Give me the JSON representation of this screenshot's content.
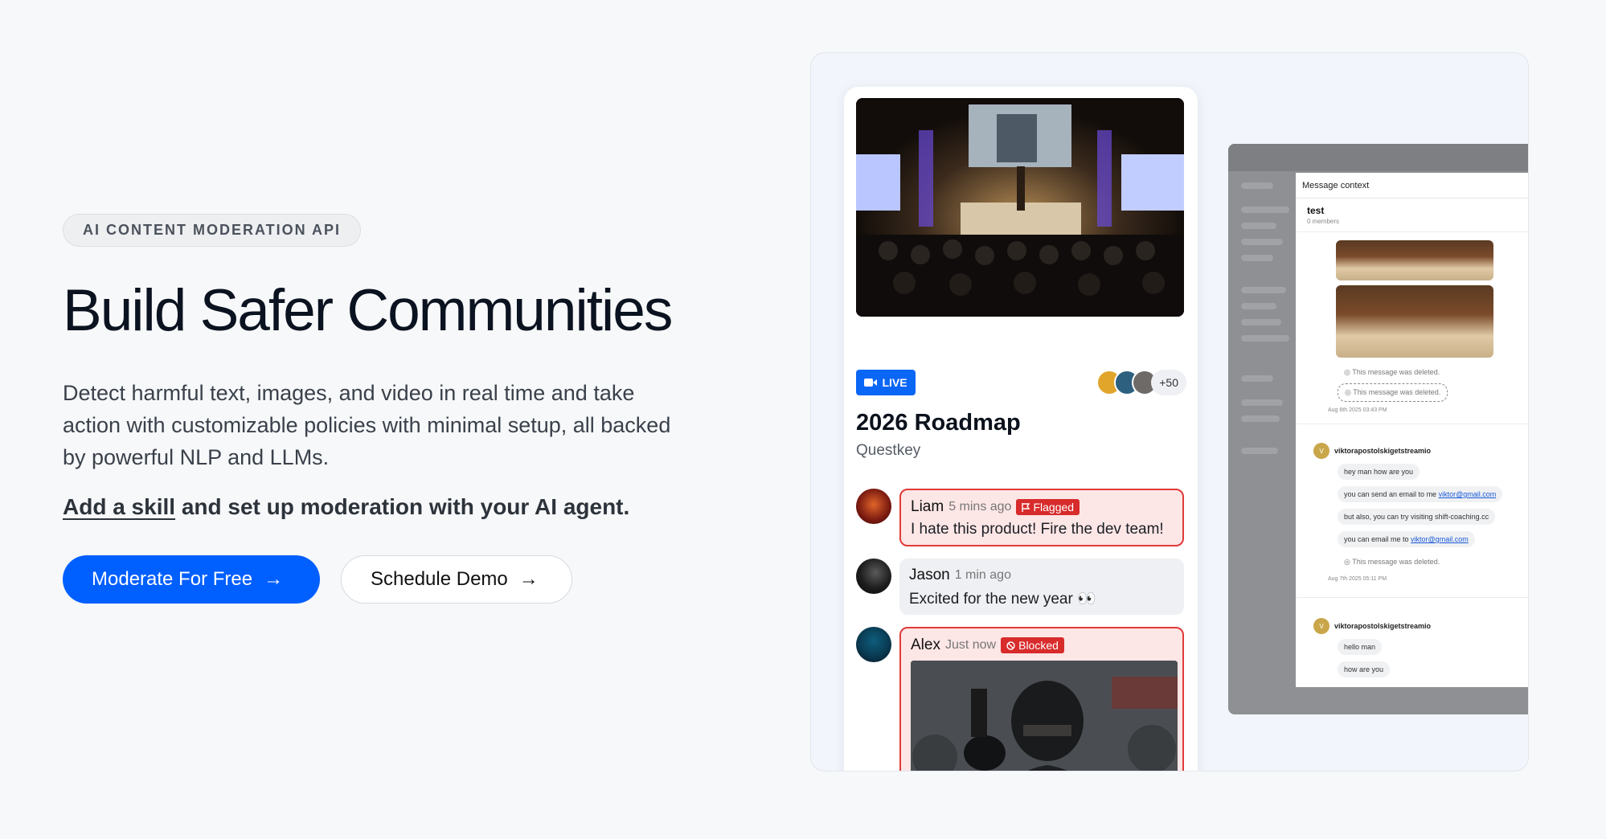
{
  "hero": {
    "eyebrow": "AI CONTENT MODERATION API",
    "title": "Build Safer Communities",
    "description": "Detect harmful text, images, and video in real time and take action with customizable policies with minimal setup, all backed by powerful NLP and LLMs.",
    "cta_link": "Add a skill",
    "cta_rest": " and set up moderation with your AI agent.",
    "primary_button": "Moderate For Free",
    "secondary_button": "Schedule Demo"
  },
  "chat": {
    "live_label": "LIVE",
    "viewer_count": "+50",
    "room_title": "2026 Roadmap",
    "room_sub": "Questkey",
    "messages": [
      {
        "name": "Liam",
        "time": "5 mins ago",
        "tag": "Flagged",
        "text": "I hate this product! Fire the dev team!"
      },
      {
        "name": "Jason",
        "time": "1 min ago",
        "text": "Excited for the new year 👀"
      },
      {
        "name": "Alex",
        "time": "Just now",
        "tag": "Blocked"
      }
    ]
  },
  "dashboard": {
    "modal_title": "Message context",
    "channel": "test",
    "members": "0 members",
    "deleted": "This message was deleted.",
    "date1": "Aug 6th 2025 03:43 PM",
    "date2": "Aug 7th 2025 05:11 PM",
    "user": "viktorapostolskigetstreamio",
    "user_initial": "V",
    "m1": "hey man how are you",
    "m2_pre": "you can send an email to me ",
    "m2_link": "viktor@gmail.com",
    "m3": "but also, you can try visiting shift-coaching.cc",
    "m4_pre": "you can email me to ",
    "m4_link": "viktor@gmail.com",
    "m5": "hello man",
    "m6": "how are you"
  },
  "colors": {
    "primary": "#005fff",
    "flag": "#d82b2b",
    "live": "#0a66f5"
  }
}
